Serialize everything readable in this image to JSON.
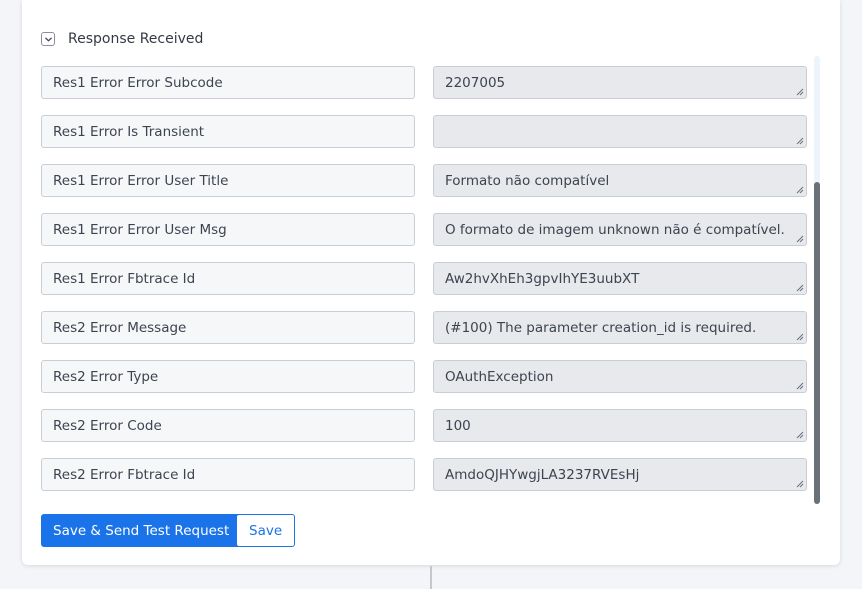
{
  "section": {
    "title": "Response Received",
    "icon": "chevron-down-icon"
  },
  "fields": [
    {
      "label": "Res1 Error Error Subcode",
      "value": "2207005"
    },
    {
      "label": "Res1 Error Is Transient",
      "value": ""
    },
    {
      "label": "Res1 Error Error User Title",
      "value": "Formato não compatível"
    },
    {
      "label": "Res1 Error Error User Msg",
      "value": "O formato de imagem unknown não é compatível."
    },
    {
      "label": "Res1 Error Fbtrace Id",
      "value": "Aw2hvXhEh3gpvIhYE3uubXT"
    },
    {
      "label": "Res2 Error Message",
      "value": "(#100) The parameter creation_id is required."
    },
    {
      "label": "Res2 Error Type",
      "value": "OAuthException"
    },
    {
      "label": "Res2 Error Code",
      "value": "100"
    },
    {
      "label": "Res2 Error Fbtrace Id",
      "value": "AmdoQJHYwgjLA3237RVEsHj"
    }
  ],
  "actions": {
    "save_and_send_label": "Save & Send Test Request",
    "save_label": "Save"
  },
  "colors": {
    "accent": "#1a73e8",
    "value_bg": "#e7e9ec",
    "label_bg": "#f6f7f9",
    "border": "#c9ced6"
  }
}
